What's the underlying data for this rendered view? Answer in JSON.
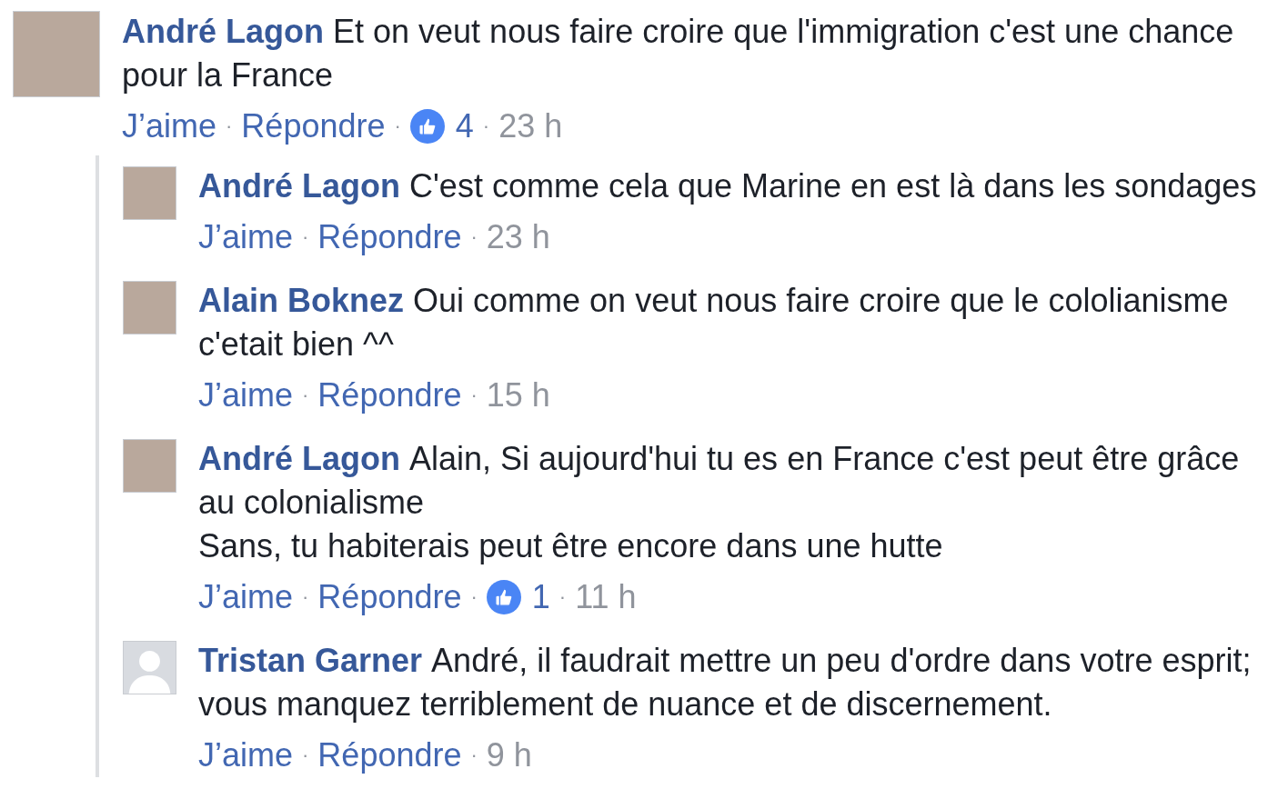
{
  "comments": [
    {
      "author": "André Lagon",
      "avatar": {
        "kind": "photo"
      },
      "text": [
        "Et on veut nous faire croire que l'immigration c'est une chance pour la France"
      ],
      "meta": [
        {
          "kind": "link",
          "text": "J’aime"
        },
        {
          "kind": "dot",
          "text": "·"
        },
        {
          "kind": "link",
          "text": "Répondre"
        },
        {
          "kind": "dot",
          "text": "·"
        },
        {
          "kind": "likes",
          "text": "4"
        },
        {
          "kind": "dot",
          "text": "·"
        },
        {
          "kind": "time",
          "text": "23 h"
        }
      ],
      "replies": [
        {
          "author": "André Lagon",
          "avatar": {
            "kind": "photo"
          },
          "text": [
            "C'est comme cela que Marine en est là dans les sondages"
          ],
          "meta": [
            {
              "kind": "link",
              "text": "J’aime"
            },
            {
              "kind": "dot",
              "text": "·"
            },
            {
              "kind": "link",
              "text": "Répondre"
            },
            {
              "kind": "dot",
              "text": "·"
            },
            {
              "kind": "time",
              "text": "23 h"
            }
          ]
        },
        {
          "author": "Alain Boknez",
          "avatar": {
            "kind": "photo"
          },
          "text": [
            "Oui comme on veut nous faire croire que le cololianisme c'etait bien ^^"
          ],
          "meta": [
            {
              "kind": "link",
              "text": "J’aime"
            },
            {
              "kind": "dot",
              "text": "·"
            },
            {
              "kind": "link",
              "text": "Répondre"
            },
            {
              "kind": "dot",
              "text": "·"
            },
            {
              "kind": "time",
              "text": "15 h"
            }
          ]
        },
        {
          "author": "André Lagon",
          "avatar": {
            "kind": "photo"
          },
          "text": [
            "Alain, Si aujourd'hui tu es en France c'est peut être grâce au colonialisme",
            "Sans, tu habiterais peut être encore dans une hutte"
          ],
          "meta": [
            {
              "kind": "link",
              "text": "J’aime"
            },
            {
              "kind": "dot",
              "text": "·"
            },
            {
              "kind": "link",
              "text": "Répondre"
            },
            {
              "kind": "dot",
              "text": "·"
            },
            {
              "kind": "likes",
              "text": "1"
            },
            {
              "kind": "dot",
              "text": "·"
            },
            {
              "kind": "time",
              "text": "11 h"
            }
          ]
        },
        {
          "author": "Tristan Garner",
          "avatar": {
            "kind": "silhouette"
          },
          "text": [
            "André, il faudrait mettre un peu d'ordre dans votre esprit; vous manquez terriblement de nuance et de discernement."
          ],
          "meta": [
            {
              "kind": "link",
              "text": "J’aime"
            },
            {
              "kind": "dot",
              "text": "·"
            },
            {
              "kind": "link",
              "text": "Répondre"
            },
            {
              "kind": "dot",
              "text": "·"
            },
            {
              "kind": "time",
              "text": "9 h"
            }
          ]
        }
      ]
    }
  ]
}
